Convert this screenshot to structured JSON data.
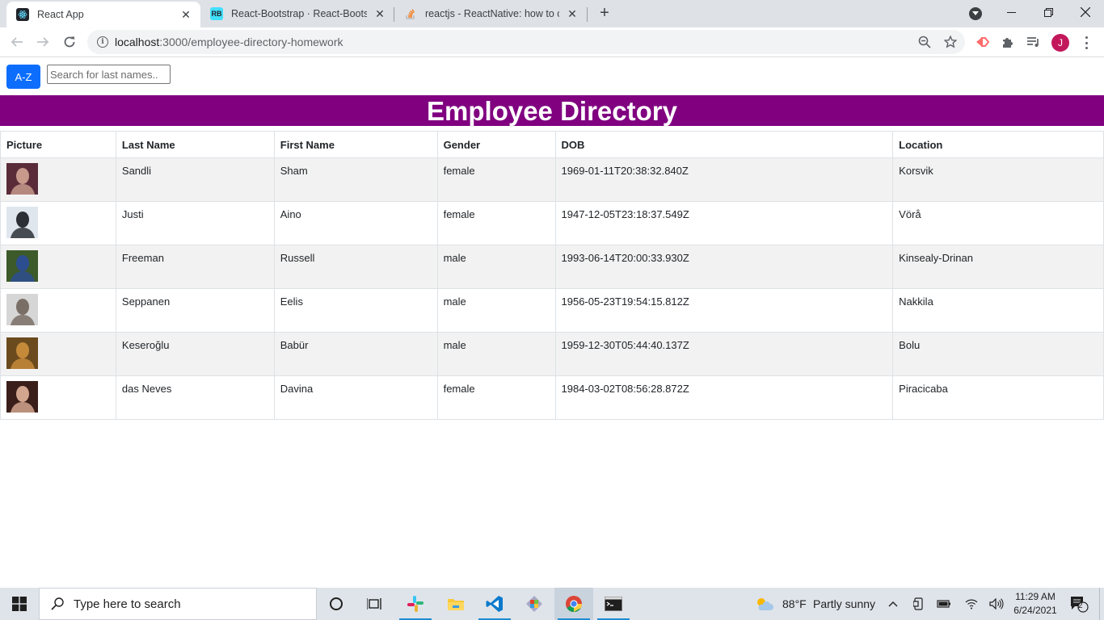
{
  "browser": {
    "tabs": [
      {
        "title": "React App",
        "active": true,
        "favicon": "react-icon"
      },
      {
        "title": "React-Bootstrap · React-Bootstrap",
        "active": false,
        "favicon": "react-bootstrap-icon"
      },
      {
        "title": "reactjs - ReactNative: how to cen",
        "active": false,
        "favicon": "stackoverflow-icon"
      }
    ],
    "url_host": "localhost",
    "url_path": ":3000/employee-directory-homework",
    "profile_initial": "J"
  },
  "controls": {
    "sort_label": "A-Z",
    "search_placeholder": "Search for last names.."
  },
  "banner": {
    "title": "Employee Directory"
  },
  "table": {
    "headers": [
      "Picture",
      "Last Name",
      "First Name",
      "Gender",
      "DOB",
      "Location"
    ],
    "rows": [
      {
        "last": "Sandli",
        "first": "Sham",
        "gender": "female",
        "dob": "1969-01-11T20:38:32.840Z",
        "location": "Korsvik",
        "photo_colors": [
          "#5a2c3a",
          "#c79a8c"
        ]
      },
      {
        "last": "Justi",
        "first": "Aino",
        "gender": "female",
        "dob": "1947-12-05T23:18:37.549Z",
        "location": "Vörå",
        "photo_colors": [
          "#dfe6ee",
          "#2d2f36"
        ]
      },
      {
        "last": "Freeman",
        "first": "Russell",
        "gender": "male",
        "dob": "1993-06-14T20:00:33.930Z",
        "location": "Kinsealy-Drinan",
        "photo_colors": [
          "#3d5a2a",
          "#2c4d8f"
        ]
      },
      {
        "last": "Seppanen",
        "first": "Eelis",
        "gender": "male",
        "dob": "1956-05-23T19:54:15.812Z",
        "location": "Nakkila",
        "photo_colors": [
          "#d6d6d6",
          "#7a6f66"
        ]
      },
      {
        "last": "Keseroğlu",
        "first": "Babür",
        "gender": "male",
        "dob": "1959-12-30T05:44:40.137Z",
        "location": "Bolu",
        "photo_colors": [
          "#6b4a1e",
          "#c48a3a"
        ]
      },
      {
        "last": "das Neves",
        "first": "Davina",
        "gender": "female",
        "dob": "1984-03-02T08:56:28.872Z",
        "location": "Piracicaba",
        "photo_colors": [
          "#3a1e1a",
          "#d2a58f"
        ]
      }
    ]
  },
  "taskbar": {
    "search_placeholder": "Type here to search",
    "weather_temp": "88°F",
    "weather_desc": "Partly sunny",
    "time": "11:29 AM",
    "date": "6/24/2021",
    "notification_count": "2"
  },
  "colors": {
    "banner": "#800080",
    "primary_button": "#0d6efd",
    "striped_row": "#f2f2f2"
  }
}
